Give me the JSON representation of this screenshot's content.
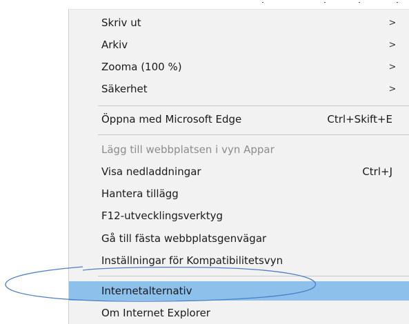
{
  "menu": {
    "items": [
      {
        "label": "Skriv ut",
        "submenu": true,
        "disabled": false,
        "highlighted": false,
        "shortcut": ""
      },
      {
        "label": "Arkiv",
        "submenu": true,
        "disabled": false,
        "highlighted": false,
        "shortcut": ""
      },
      {
        "label": "Zooma (100 %)",
        "submenu": true,
        "disabled": false,
        "highlighted": false,
        "shortcut": ""
      },
      {
        "label": "Säkerhet",
        "submenu": true,
        "disabled": false,
        "highlighted": false,
        "shortcut": ""
      },
      {
        "label": "Öppna med Microsoft Edge",
        "submenu": false,
        "disabled": false,
        "highlighted": false,
        "shortcut": "Ctrl+Skift+E"
      },
      {
        "label": "Lägg till webbplatsen i vyn Appar",
        "submenu": false,
        "disabled": true,
        "highlighted": false,
        "shortcut": ""
      },
      {
        "label": "Visa nedladdningar",
        "submenu": false,
        "disabled": false,
        "highlighted": false,
        "shortcut": "Ctrl+J"
      },
      {
        "label": "Hantera tillägg",
        "submenu": false,
        "disabled": false,
        "highlighted": false,
        "shortcut": ""
      },
      {
        "label": "F12-utvecklingsverktyg",
        "submenu": false,
        "disabled": false,
        "highlighted": false,
        "shortcut": ""
      },
      {
        "label": "Gå till fästa webbplatsgenvägar",
        "submenu": false,
        "disabled": false,
        "highlighted": false,
        "shortcut": ""
      },
      {
        "label": "Inställningar för Kompatibilitetsvyn",
        "submenu": false,
        "disabled": false,
        "highlighted": false,
        "shortcut": ""
      },
      {
        "label": "Internetalternativ",
        "submenu": false,
        "disabled": false,
        "highlighted": true,
        "shortcut": ""
      },
      {
        "label": "Om Internet Explorer",
        "submenu": false,
        "disabled": false,
        "highlighted": false,
        "shortcut": ""
      }
    ],
    "submenu_arrow": ">",
    "highlight_color": "#8dc0ea",
    "disabled_color": "#8c8c8c"
  },
  "annotation": {
    "shape": "ellipse",
    "color": "#4a7fc8",
    "target": "Internetalternativ"
  }
}
